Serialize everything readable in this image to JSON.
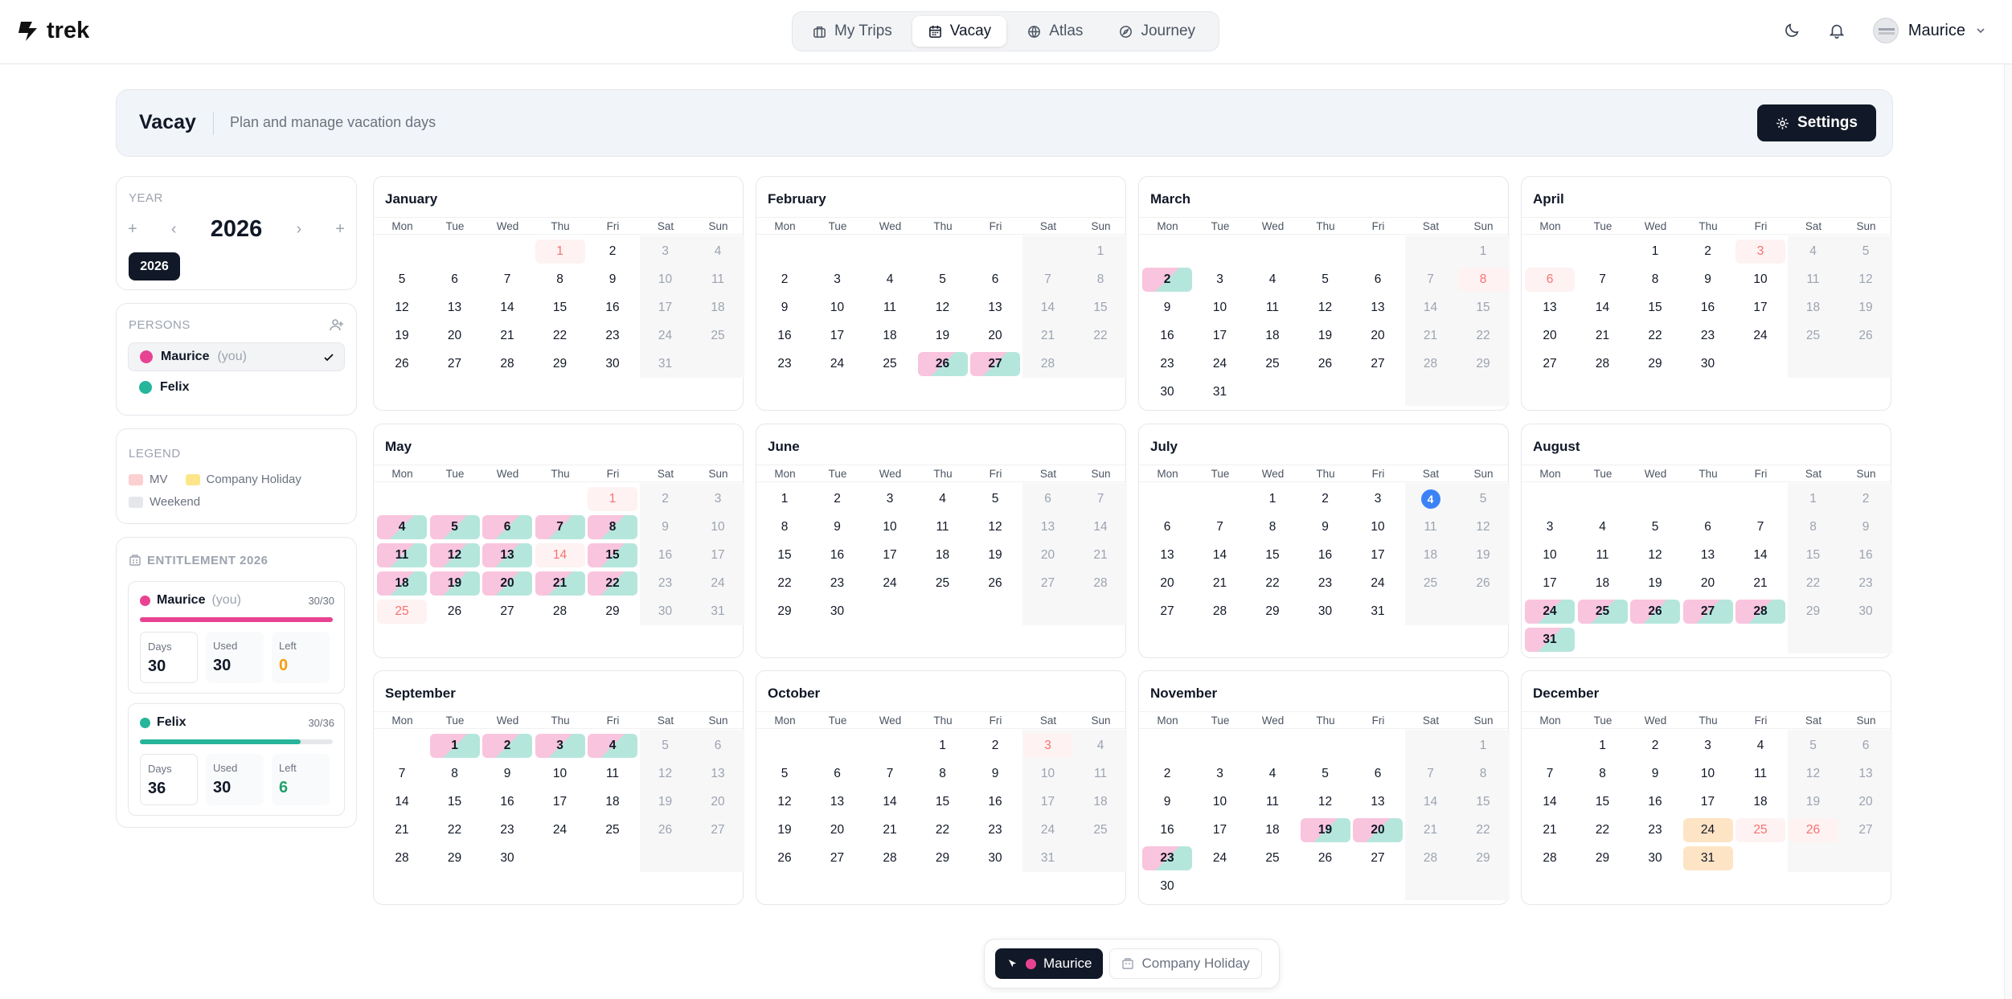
{
  "app": {
    "name": "trek"
  },
  "nav": {
    "tabs": [
      {
        "label": "My Trips",
        "icon": "briefcase-icon"
      },
      {
        "label": "Vacay",
        "icon": "calendar-icon",
        "active": true
      },
      {
        "label": "Atlas",
        "icon": "globe-icon"
      },
      {
        "label": "Journey",
        "icon": "compass-icon"
      }
    ]
  },
  "user": {
    "name": "Maurice"
  },
  "header": {
    "title": "Vacay",
    "subtitle": "Plan and manage vacation days",
    "settings_label": "Settings"
  },
  "year_card": {
    "label": "YEAR",
    "year": "2026",
    "badge": "2026"
  },
  "persons_card": {
    "label": "PERSONS",
    "persons": [
      {
        "name": "Maurice",
        "you": "(you)",
        "color": "#e84393",
        "selected": true
      },
      {
        "name": "Felix",
        "color": "#26b59a"
      }
    ]
  },
  "legend_card": {
    "label": "LEGEND",
    "items": [
      {
        "label": "MV",
        "color": "#fbd0d0"
      },
      {
        "label": "Company Holiday",
        "color": "#fde68a"
      },
      {
        "label": "Weekend",
        "color": "#e5e7eb"
      }
    ]
  },
  "entitlement_card": {
    "label": "ENTITLEMENT 2026",
    "people": [
      {
        "name": "Maurice",
        "you": "(you)",
        "color": "#e84393",
        "ratio": "30/30",
        "fill": 1.0,
        "days_label": "Days",
        "days": "30",
        "used_label": "Used",
        "used": "30",
        "left_label": "Left",
        "left": "0",
        "left_color": "#f59e0b"
      },
      {
        "name": "Felix",
        "you": "",
        "color": "#26b59a",
        "ratio": "30/36",
        "fill": 0.833,
        "days_label": "Days",
        "days": "36",
        "used_label": "Used",
        "used": "30",
        "left_label": "Left",
        "left": "6",
        "left_color": "#22a06b"
      }
    ]
  },
  "calendar": {
    "weekdays": [
      "Mon",
      "Tue",
      "Wed",
      "Thu",
      "Fri",
      "Sat",
      "Sun"
    ],
    "months": [
      {
        "name": "January",
        "offset": 3,
        "days": 31
      },
      {
        "name": "February",
        "offset": 6,
        "days": 28
      },
      {
        "name": "March",
        "offset": 6,
        "days": 31
      },
      {
        "name": "April",
        "offset": 2,
        "days": 30
      },
      {
        "name": "May",
        "offset": 4,
        "days": 31
      },
      {
        "name": "June",
        "offset": 0,
        "days": 30
      },
      {
        "name": "July",
        "offset": 2,
        "days": 31
      },
      {
        "name": "August",
        "offset": 5,
        "days": 31
      },
      {
        "name": "September",
        "offset": 1,
        "days": 30
      },
      {
        "name": "October",
        "offset": 3,
        "days": 31
      },
      {
        "name": "November",
        "offset": 6,
        "days": 30
      },
      {
        "name": "December",
        "offset": 1,
        "days": 31
      }
    ],
    "public_holidays": {
      "1": [
        1
      ],
      "3": [
        8
      ],
      "4": [
        3,
        6
      ],
      "5": [
        1,
        14,
        25
      ],
      "10": [
        3
      ],
      "11": [],
      "12": [
        25,
        26
      ]
    },
    "company_holidays": {
      "12": [
        24,
        31
      ]
    },
    "vacation_both": {
      "2": [
        26,
        27
      ],
      "3": [
        2
      ],
      "5": [
        4,
        5,
        6,
        7,
        8,
        11,
        12,
        13,
        15,
        18,
        19,
        20,
        21,
        22
      ],
      "8": [
        24,
        25,
        26,
        27,
        28,
        31
      ],
      "9": [
        1,
        2,
        3,
        4
      ],
      "11": [
        19,
        20,
        23
      ]
    },
    "today": {
      "month": 7,
      "day": 4
    }
  },
  "bottom_bar": {
    "active_label": "Maurice",
    "active_color": "#e84393",
    "company_label": "Company Holiday"
  },
  "colors": {
    "pink": "#f9c4dd",
    "teal": "#b5e6dc",
    "holiday_text": "#f87171",
    "company": "#fde4c4",
    "today": "#3b82f6"
  }
}
